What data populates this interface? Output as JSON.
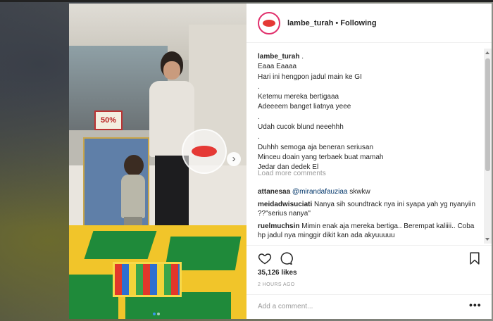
{
  "post": {
    "username": "lambe_turah",
    "separator": "•",
    "follow_status": "Following",
    "price_sign": "50%",
    "caption_user": "lambe_turah",
    "caption_after_user": " .",
    "caption_lines": [
      "Eaaa Eaaaa",
      "Hari ini hengpon jadul main ke GI",
      ".",
      "Ketemu mereka bertigaaa",
      "Adeeeem banget liatnya yeee",
      ".",
      "Udah cucok blund neeehhh",
      ".",
      "Duhhh semoga aja beneran seriusan",
      "Minceu doain yang terbaek buat mamah",
      "Jedar dan dedek El"
    ],
    "load_more": "Load more comments",
    "comments": [
      {
        "user": "attanesaa",
        "mention": "@mirandafauziaa",
        "text": " skwkw"
      },
      {
        "user": "meidadwisuciati",
        "mention": "",
        "text": " Nanya sih soundtrack nya ini syapa yah yg nyanyiin ??\"serius nanya\""
      },
      {
        "user": "ruelmuchsin",
        "mention": "",
        "text": " Mimin enak aja mereka bertiga.. Berempat kaliiii.. Coba hp jadul nya minggir dikit kan ada akyuuuuu"
      }
    ],
    "likes": "35,126 likes",
    "time": "2 HOURS AGO",
    "comment_placeholder": "Add a comment...",
    "more_glyph": "•••",
    "next_glyph": "›"
  },
  "icons": {
    "like": "heart-icon",
    "comment": "speech-bubble-icon",
    "save": "bookmark-icon",
    "next": "chevron-right-icon",
    "more": "more-options-icon"
  },
  "colors": {
    "text": "#262626",
    "muted": "#999999",
    "link": "#003569",
    "brand_lips": "#e53935",
    "carousel_active": "#3897f0"
  }
}
